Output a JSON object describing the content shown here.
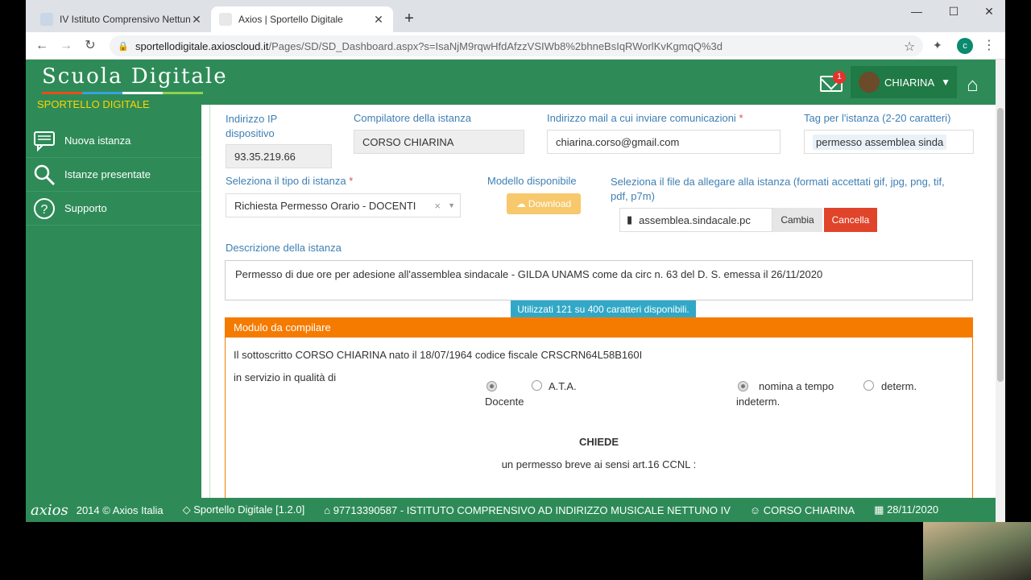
{
  "browser": {
    "tabs": [
      {
        "title": "IV Istituto Comprensivo Nettuno",
        "active": false
      },
      {
        "title": "Axios | Sportello Digitale",
        "active": true
      }
    ],
    "url_host": "sportellodigitale.axioscloud.it",
    "url_path": "/Pages/SD/SD_Dashboard.aspx?s=IsaNjM9rqwHfdAfzzVSIWb8%2bhneBsIqRWorlKvKgmqQ%3d",
    "profile_initial": "c"
  },
  "header": {
    "logo": "Scuola Digitale",
    "mail_badge": "1",
    "user": "CHIARINA"
  },
  "sidebar": {
    "subtitle": "SPORTELLO DIGITALE",
    "items": [
      {
        "label": "Nuova istanza",
        "icon": "chat-icon"
      },
      {
        "label": "Istanze presentate",
        "icon": "search-icon"
      },
      {
        "label": "Supporto",
        "icon": "help-icon"
      }
    ]
  },
  "form": {
    "ip_label": "Indirizzo IP dispositivo",
    "ip_value": "93.35.219.66",
    "compiler_label": "Compilatore della istanza",
    "compiler_value": "CORSO CHIARINA",
    "mail_label": "Indirizzo mail a cui inviare comunicazioni",
    "mail_value": "chiarina.corso@gmail.com",
    "tag_label": "Tag per l'istanza (2-20 caratteri)",
    "tag_value": "permesso assemblea sinda",
    "type_label": "Seleziona il tipo di istanza",
    "type_value": "Richiesta Permesso Orario - DOCENTI",
    "model_label": "Modello disponibile",
    "download_label": "Download",
    "file_label": "Seleziona il file da allegare alla istanza (formati accettati gif, jpg, png, tif, pdf, p7m)",
    "file_value": "assemblea.sindacale.pc",
    "change_label": "Cambia",
    "cancel_label": "Cancella",
    "desc_label": "Descrizione della istanza",
    "desc_value": "Permesso di due ore per adesione all'assemblea sindacale - GILDA UNAMS come da  circ n. 63 del D. S. emessa il 26/11/2020",
    "counter": "Utilizzati 121 su 400 caratteri disponibili.",
    "required_mark": "*"
  },
  "modulo": {
    "title": "Modulo da compilare",
    "line1": "Il sottoscritto CORSO CHIARINA nato il 18/07/1964 codice fiscale CRSCRN64L58B160I",
    "line2": "in servizio in qualità di",
    "opt_docente": "Docente",
    "opt_ata": "A.T.A.",
    "opt_indeterm_a": "nomina a tempo",
    "opt_indeterm_b": "indeterm.",
    "opt_determ": "determ.",
    "chiede": "CHIEDE",
    "line3": "un permesso breve ai sensi art.16 CCNL :"
  },
  "footer": {
    "brand": "axios",
    "copyright": "2014 © Axios Italia",
    "version": "Sportello Digitale [1.2.0]",
    "school": "97713390587 - ISTITUTO COMPRENSIVO AD INDIRIZZO MUSICALE NETTUNO IV",
    "user": "CORSO CHIARINA",
    "date": "28/11/2020"
  }
}
